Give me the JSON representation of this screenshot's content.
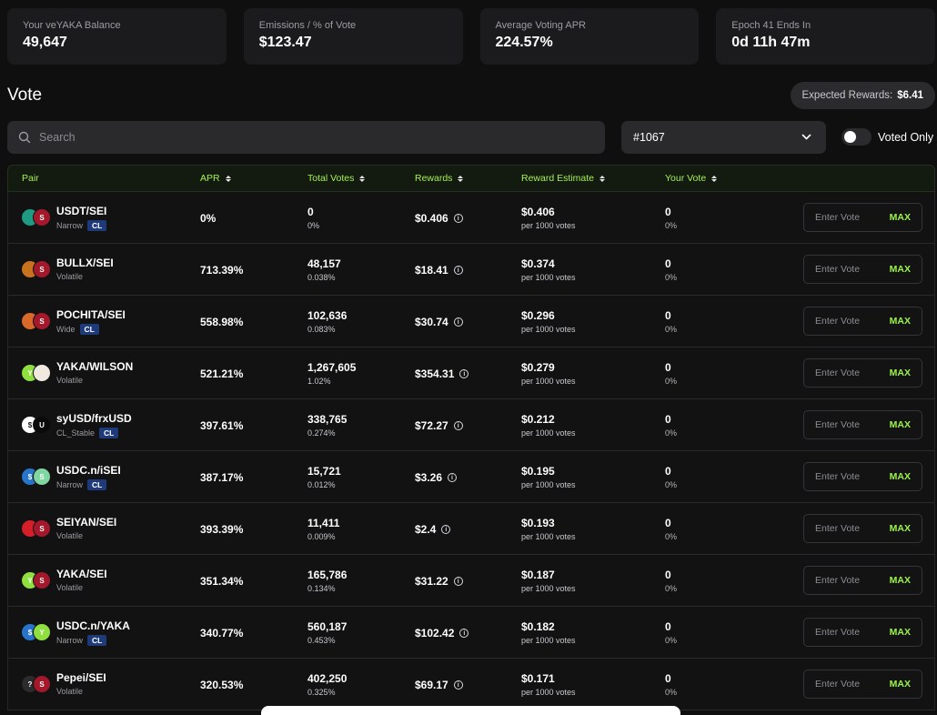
{
  "stats": [
    {
      "label": "Your veYAKA Balance",
      "value": "49,647"
    },
    {
      "label": "Emissions / % of Vote",
      "value": "$123.47"
    },
    {
      "label": "Average Voting APR",
      "value": "224.57%"
    },
    {
      "label": "Epoch 41 Ends In",
      "value": "0d 11h 47m"
    }
  ],
  "vote_title": "Vote",
  "expected_rewards": {
    "label": "Expected Rewards:",
    "value": "$6.41"
  },
  "search": {
    "placeholder": "Search",
    "icon": "search-icon"
  },
  "select": {
    "value": "#1067",
    "icon": "chevron-down-icon"
  },
  "voted_only": {
    "label": "Voted Only",
    "on": false
  },
  "columns": {
    "pair": "Pair",
    "apr": "APR",
    "total_votes": "Total Votes",
    "rewards": "Rewards",
    "reward_estimate": "Reward Estimate",
    "your_vote": "Your Vote"
  },
  "row_common": {
    "per_votes": "per 1000 votes",
    "vote_placeholder": "Enter Vote",
    "max_label": "MAX",
    "info_glyph": "i"
  },
  "rows": [
    {
      "pair": "USDT/SEI",
      "type": "Narrow",
      "cl": "CL",
      "apr": "0%",
      "votes": "0",
      "votes_pct": "0%",
      "rewards": "$0.406",
      "estimate": "$0.406",
      "your_vote": "0",
      "your_pct": "0%",
      "icons": [
        "usdt-token-icon",
        "sei-token-icon"
      ]
    },
    {
      "pair": "BULLX/SEI",
      "type": "Volatile",
      "cl": "",
      "apr": "713.39%",
      "votes": "48,157",
      "votes_pct": "0.038%",
      "rewards": "$18.41",
      "estimate": "$0.374",
      "your_vote": "0",
      "your_pct": "0%",
      "icons": [
        "bullx-token-icon",
        "sei-token-icon"
      ]
    },
    {
      "pair": "POCHITA/SEI",
      "type": "Wide",
      "cl": "CL",
      "apr": "558.98%",
      "votes": "102,636",
      "votes_pct": "0.083%",
      "rewards": "$30.74",
      "estimate": "$0.296",
      "your_vote": "0",
      "your_pct": "0%",
      "icons": [
        "pochita-token-icon",
        "sei-token-icon"
      ]
    },
    {
      "pair": "YAKA/WILSON",
      "type": "Volatile",
      "cl": "",
      "apr": "521.21%",
      "votes": "1,267,605",
      "votes_pct": "1.02%",
      "rewards": "$354.31",
      "estimate": "$0.279",
      "your_vote": "0",
      "your_pct": "0%",
      "icons": [
        "yaka-token-icon",
        "wilson-token-icon"
      ]
    },
    {
      "pair": "syUSD/frxUSD",
      "type": "CL_Stable",
      "cl": "CL",
      "apr": "397.61%",
      "votes": "338,765",
      "votes_pct": "0.274%",
      "rewards": "$72.27",
      "estimate": "$0.212",
      "your_vote": "0",
      "your_pct": "0%",
      "icons": [
        "syusd-token-icon",
        "frxusd-token-icon"
      ]
    },
    {
      "pair": "USDC.n/iSEI",
      "type": "Narrow",
      "cl": "CL",
      "apr": "387.17%",
      "votes": "15,721",
      "votes_pct": "0.012%",
      "rewards": "$3.26",
      "estimate": "$0.195",
      "your_vote": "0",
      "your_pct": "0%",
      "icons": [
        "usdc-token-icon",
        "isei-token-icon"
      ]
    },
    {
      "pair": "SEIYAN/SEI",
      "type": "Volatile",
      "cl": "",
      "apr": "393.39%",
      "votes": "11,411",
      "votes_pct": "0.009%",
      "rewards": "$2.4",
      "estimate": "$0.193",
      "your_vote": "0",
      "your_pct": "0%",
      "icons": [
        "seiyan-token-icon",
        "sei-token-icon"
      ]
    },
    {
      "pair": "YAKA/SEI",
      "type": "Volatile",
      "cl": "",
      "apr": "351.34%",
      "votes": "165,786",
      "votes_pct": "0.134%",
      "rewards": "$31.22",
      "estimate": "$0.187",
      "your_vote": "0",
      "your_pct": "0%",
      "icons": [
        "yaka-token-icon",
        "sei-token-icon"
      ]
    },
    {
      "pair": "USDC.n/YAKA",
      "type": "Narrow",
      "cl": "CL",
      "apr": "340.77%",
      "votes": "560,187",
      "votes_pct": "0.453%",
      "rewards": "$102.42",
      "estimate": "$0.182",
      "your_vote": "0",
      "your_pct": "0%",
      "icons": [
        "usdc-token-icon",
        "yaka-token-icon"
      ]
    },
    {
      "pair": "Pepei/SEI",
      "type": "Volatile",
      "cl": "",
      "apr": "320.53%",
      "votes": "402,250",
      "votes_pct": "0.325%",
      "rewards": "$69.17",
      "estimate": "$0.171",
      "your_vote": "0",
      "your_pct": "0%",
      "icons": [
        "pepei-token-icon",
        "sei-token-icon"
      ]
    }
  ],
  "colors": {
    "accent": "#9cf34a",
    "cl_badge": "#1e3a7a",
    "background": "#0f0f10",
    "card": "#1b1b1d"
  }
}
